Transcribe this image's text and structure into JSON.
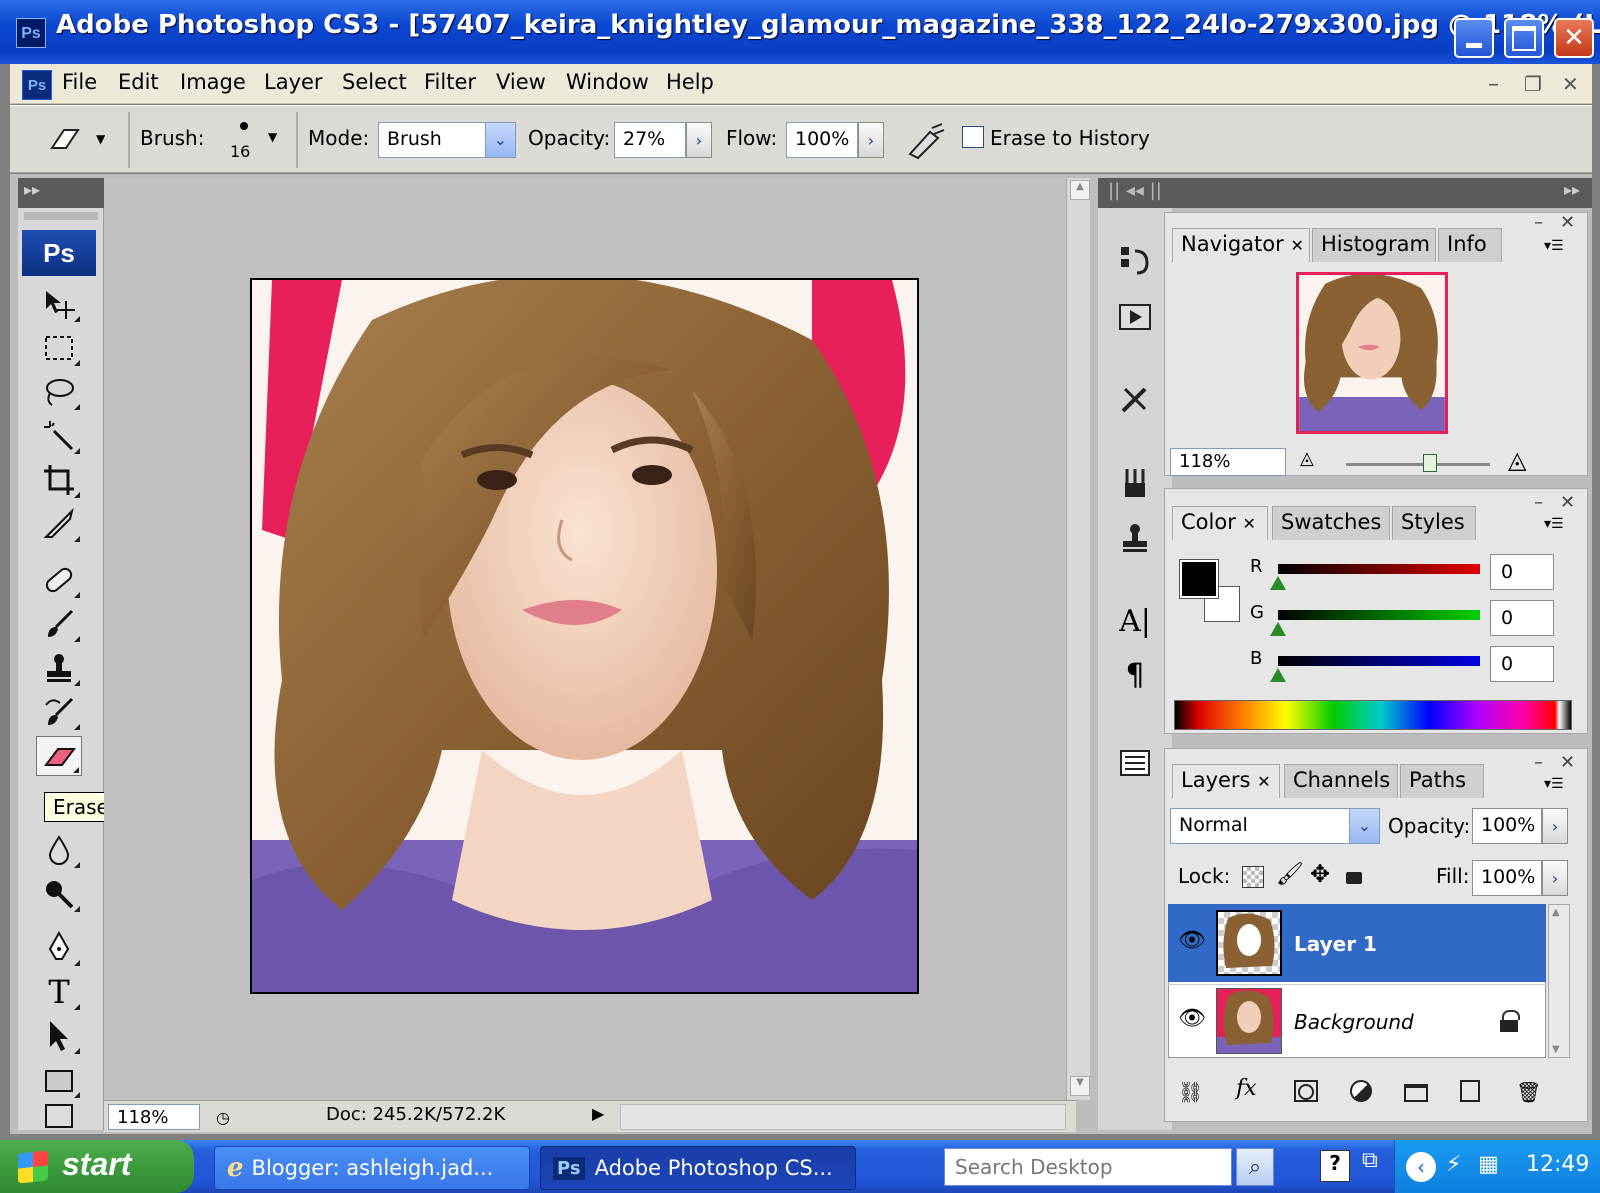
{
  "window": {
    "app_badge": "Ps",
    "title": "Adobe Photoshop CS3 - [57407_keira_knightley_glamour_magazine_338_122_24lo-279x300.jpg @ 118% (L..."
  },
  "menu": [
    "File",
    "Edit",
    "Image",
    "Layer",
    "Select",
    "Filter",
    "View",
    "Window",
    "Help"
  ],
  "options": {
    "brush_label": "Brush:",
    "brush_size": "16",
    "mode_label": "Mode:",
    "mode_value": "Brush",
    "opacity_label": "Opacity:",
    "opacity_value": "27%",
    "flow_label": "Flow:",
    "flow_value": "100%",
    "erase_history_label": "Erase to History"
  },
  "toolbox": {
    "badge": "Ps",
    "tooltip": "Eraser Tool (E)"
  },
  "status": {
    "zoom": "118%",
    "doc": "Doc: 245.2K/572.2K"
  },
  "navigator": {
    "tabs": [
      "Navigator",
      "Histogram",
      "Info"
    ],
    "zoom": "118%",
    "zoom_slider_fraction": 0.58
  },
  "color_panel": {
    "tabs": [
      "Color",
      "Swatches",
      "Styles"
    ],
    "channels": [
      {
        "label": "R",
        "value": "0",
        "color": "#e00000"
      },
      {
        "label": "G",
        "value": "0",
        "color": "#00d000"
      },
      {
        "label": "B",
        "value": "0",
        "color": "#0000e0"
      }
    ],
    "foreground": "#000000",
    "background": "#ffffff"
  },
  "layers_panel": {
    "tabs": [
      "Layers",
      "Channels",
      "Paths"
    ],
    "blend_mode": "Normal",
    "opacity_label": "Opacity:",
    "opacity_value": "100%",
    "lock_label": "Lock:",
    "fill_label": "Fill:",
    "fill_value": "100%",
    "layers": [
      {
        "name": "Layer 1",
        "selected": true
      },
      {
        "name": "Background",
        "selected": false,
        "locked": true
      }
    ]
  },
  "taskbar": {
    "start": "start",
    "items": [
      "Blogger: ashleigh.jad...",
      "Adobe Photoshop CS..."
    ],
    "search_placeholder": "Search Desktop",
    "clock": "12:49"
  },
  "colors": {
    "titlebar": "#0a46d0",
    "selection": "#3169c6",
    "taskbar": "#245fdc",
    "start": "#3c9c3c"
  }
}
